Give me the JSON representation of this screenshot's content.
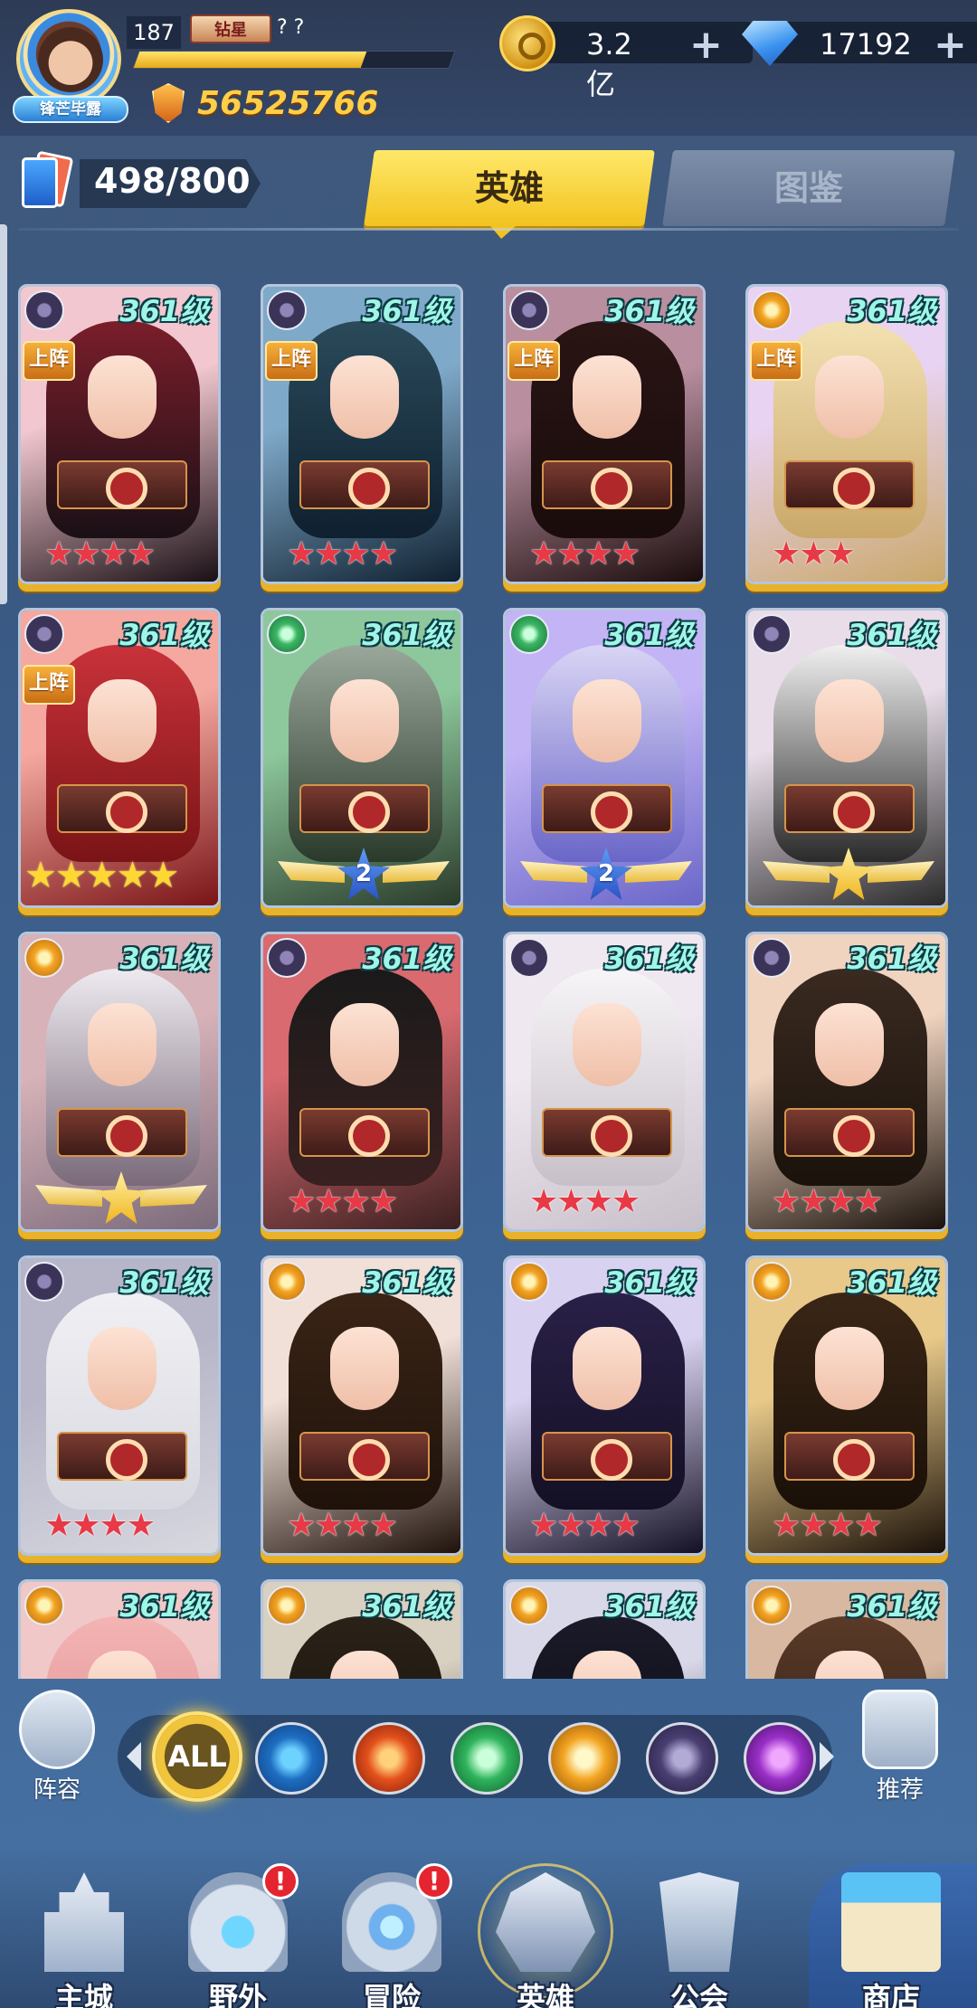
{
  "player": {
    "level": "187",
    "rank_badge": "钻星",
    "rank_text": "? ?",
    "avatar_tag": "锋芒毕露",
    "power": "56525766"
  },
  "currencies": {
    "gold": {
      "icon": "gold-coin-icon",
      "value": "3.2亿"
    },
    "diamond": {
      "icon": "diamond-icon",
      "value": "17192"
    }
  },
  "header": {
    "hero_count": "498/800",
    "tabs": [
      {
        "label": "英雄",
        "active": true
      },
      {
        "label": "图鉴",
        "active": false
      }
    ]
  },
  "heroes": [
    {
      "level": "361级",
      "faction": "dark",
      "on_team": "上阵",
      "stars": "★★★★",
      "star_type": "red"
    },
    {
      "level": "361级",
      "faction": "dark",
      "on_team": "上阵",
      "stars": "★★★★",
      "star_type": "red"
    },
    {
      "level": "361级",
      "faction": "dark",
      "on_team": "上阵",
      "stars": "★★★★",
      "star_type": "red"
    },
    {
      "level": "361级",
      "faction": "light",
      "on_team": "上阵",
      "stars": "★★★",
      "star_type": "red"
    },
    {
      "level": "361级",
      "faction": "dark",
      "on_team": "上阵",
      "stars": "★★★★★",
      "star_type": "gold"
    },
    {
      "level": "361级",
      "faction": "wind",
      "on_team": "",
      "stars": "",
      "star_type": "rank",
      "rank": "2"
    },
    {
      "level": "361级",
      "faction": "wind",
      "on_team": "",
      "stars": "",
      "star_type": "rank",
      "rank": "2"
    },
    {
      "level": "361级",
      "faction": "dark",
      "on_team": "",
      "stars": "",
      "star_type": "goldstar"
    },
    {
      "level": "361级",
      "faction": "light",
      "on_team": "",
      "stars": "",
      "star_type": "goldstar"
    },
    {
      "level": "361级",
      "faction": "dark",
      "on_team": "",
      "stars": "★★★★",
      "star_type": "red"
    },
    {
      "level": "361级",
      "faction": "dark",
      "on_team": "",
      "stars": "★★★★",
      "star_type": "red"
    },
    {
      "level": "361级",
      "faction": "dark",
      "on_team": "",
      "stars": "★★★★",
      "star_type": "red"
    },
    {
      "level": "361级",
      "faction": "dark",
      "on_team": "",
      "stars": "★★★★",
      "star_type": "red"
    },
    {
      "level": "361级",
      "faction": "light",
      "on_team": "",
      "stars": "★★★★",
      "star_type": "red"
    },
    {
      "level": "361级",
      "faction": "light",
      "on_team": "",
      "stars": "★★★★",
      "star_type": "red"
    },
    {
      "level": "361级",
      "faction": "light",
      "on_team": "",
      "stars": "★★★★",
      "star_type": "red"
    },
    {
      "level": "361级",
      "faction": "light",
      "on_team": "",
      "stars": "",
      "star_type": "none"
    },
    {
      "level": "361级",
      "faction": "light",
      "on_team": "",
      "stars": "",
      "star_type": "none"
    },
    {
      "level": "361级",
      "faction": "light",
      "on_team": "",
      "stars": "",
      "star_type": "none"
    },
    {
      "level": "361级",
      "faction": "light",
      "on_team": "",
      "stars": "",
      "star_type": "none"
    }
  ],
  "filters": {
    "lineup_label": "阵容",
    "recommend_label": "推荐",
    "all_label": "ALL",
    "factions": [
      "water-faction-icon",
      "fire-faction-icon",
      "wind-faction-icon",
      "light-faction-icon",
      "dark-faction-icon",
      "void-faction-icon"
    ]
  },
  "nav": [
    {
      "label": "主城",
      "alert": ""
    },
    {
      "label": "野外",
      "alert": "!"
    },
    {
      "label": "冒险",
      "alert": "!"
    },
    {
      "label": "英雄",
      "alert": "",
      "active": true
    },
    {
      "label": "公会",
      "alert": ""
    },
    {
      "label": "商店",
      "alert": ""
    }
  ],
  "colors": {
    "accent_yellow": "#f2c320",
    "level_text": "#9ff6e6",
    "background": "#3d6392"
  }
}
